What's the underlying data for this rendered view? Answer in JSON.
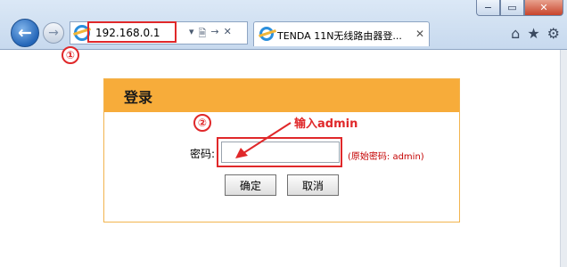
{
  "browser": {
    "back_icon": "back-arrow-icon",
    "forward_icon": "forward-arrow-icon",
    "address": "192.168.0.1",
    "address_tools": [
      "▾",
      "🗎",
      "→",
      "✕"
    ],
    "tab_title": "TENDA 11N无线路由器登...",
    "tab_close": "✕",
    "toolbar": [
      "⌂",
      "★",
      "⚙"
    ],
    "window_controls": [
      "−",
      "▭",
      "✕"
    ]
  },
  "annotations": {
    "step1": "①",
    "step2": "②",
    "input_instruction": "输入admin"
  },
  "login": {
    "title": "登录",
    "password_label": "密码:",
    "password_value": "",
    "hint": "(原始密码: admin)",
    "ok_label": "确定",
    "cancel_label": "取消"
  },
  "colors": {
    "header": "#f7ac3a",
    "border": "#f2b44f",
    "annotation": "#e0282a"
  }
}
